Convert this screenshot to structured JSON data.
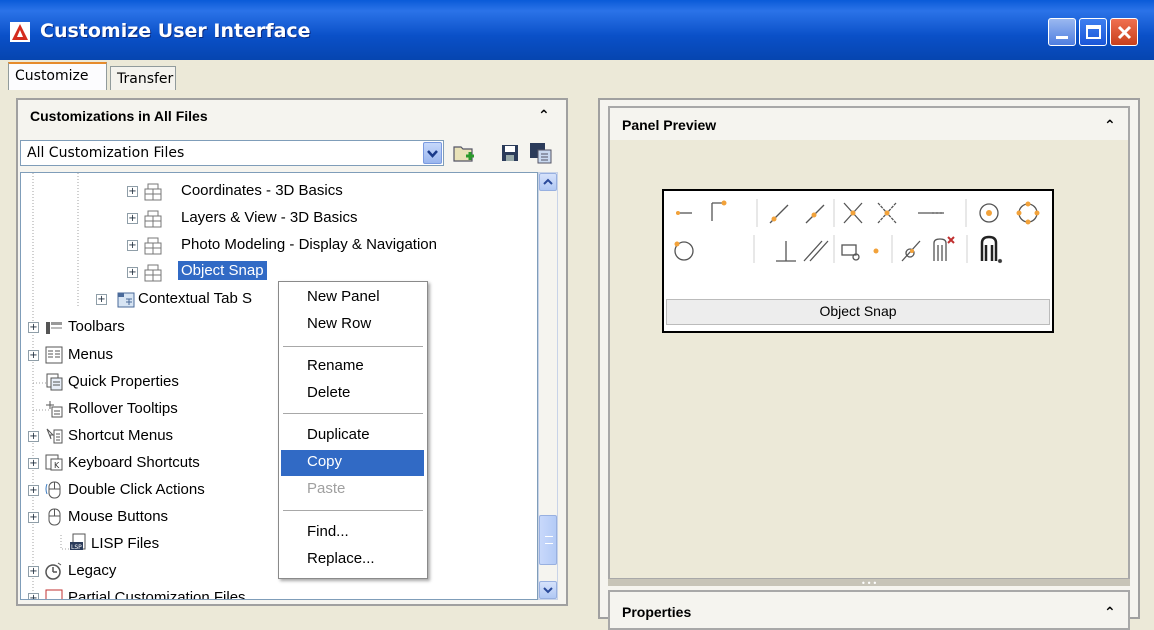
{
  "window": {
    "title": "Customize User Interface"
  },
  "tabs": [
    {
      "label": "Customize",
      "active": true
    },
    {
      "label": "Transfer",
      "active": false
    }
  ],
  "left_panel": {
    "header": "Customizations in All Files",
    "dropdown_value": "All Customization Files",
    "tree": [
      {
        "label": "Coordinates - 3D Basics",
        "icon": "panel-icon"
      },
      {
        "label": "Layers & View - 3D Basics",
        "icon": "panel-icon"
      },
      {
        "label": "Photo Modeling - Display & Navigation",
        "icon": "panel-icon"
      },
      {
        "label": "Object Snap",
        "icon": "panel-icon",
        "selected": true
      },
      {
        "label": "Contextual Tab S",
        "icon": "contextual-tab-icon"
      },
      {
        "label": "Toolbars",
        "icon": "toolbars-icon"
      },
      {
        "label": "Menus",
        "icon": "menus-icon"
      },
      {
        "label": "Quick Properties",
        "icon": "quick-properties-icon"
      },
      {
        "label": "Rollover Tooltips",
        "icon": "rollover-tooltips-icon"
      },
      {
        "label": "Shortcut Menus",
        "icon": "shortcut-menus-icon"
      },
      {
        "label": "Keyboard Shortcuts",
        "icon": "keyboard-icon"
      },
      {
        "label": "Double Click Actions",
        "icon": "mouse-icon"
      },
      {
        "label": "Mouse Buttons",
        "icon": "mouse-icon"
      },
      {
        "label": "LISP Files",
        "icon": "lisp-icon"
      },
      {
        "label": "Legacy",
        "icon": "legacy-icon"
      },
      {
        "label": "Partial Customization Files",
        "icon": "partial-files-icon"
      }
    ]
  },
  "context_menu": {
    "items": [
      "New Panel",
      "New Row",
      "Rename",
      "Delete",
      "Duplicate",
      "Copy",
      "Paste",
      "Find...",
      "Replace..."
    ],
    "highlighted": "Copy",
    "disabled": [
      "Paste"
    ]
  },
  "right_panel": {
    "preview_header": "Panel Preview",
    "preview_panel_label": "Object Snap",
    "properties_header": "Properties"
  },
  "colors": {
    "selection": "#316ac5",
    "titlebar": "#0a50c8"
  }
}
